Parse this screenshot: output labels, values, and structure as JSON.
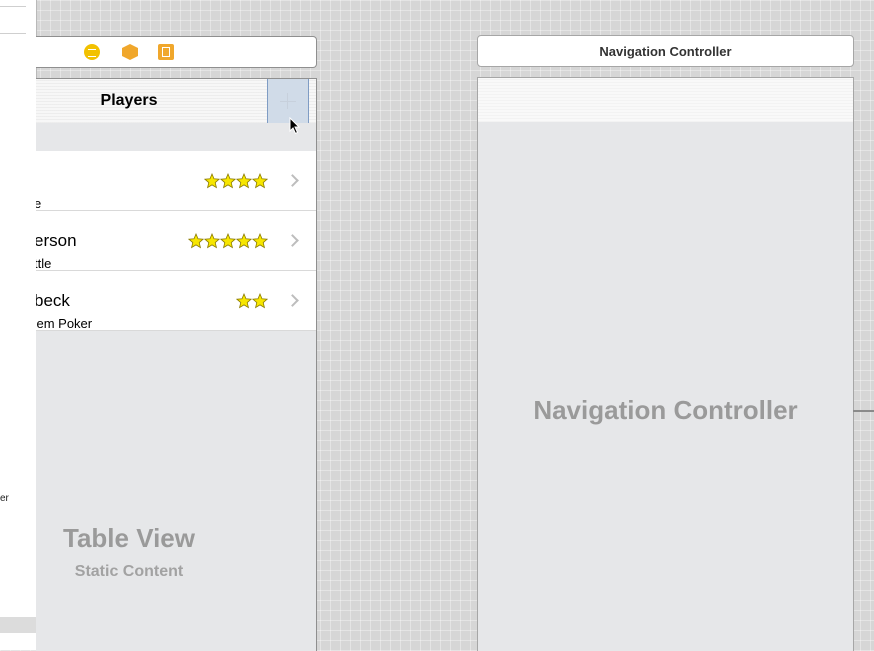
{
  "left_panel": {
    "fragment_text": "er"
  },
  "table_scene": {
    "dock_icons": [
      "view-controller-icon",
      "first-responder-icon",
      "exit-icon"
    ],
    "nav_title": "Players",
    "add_button_icon": "plus-icon",
    "cells": [
      {
        "name": "",
        "subtitle": "e",
        "rating": 4
      },
      {
        "name": "erson",
        "subtitle": "ttle",
        "rating": 5
      },
      {
        "name": "beck",
        "subtitle": "'em Poker",
        "rating": 2
      }
    ],
    "content_title": "Table View",
    "content_subtitle": "Static Content"
  },
  "nav_scene": {
    "dock_title": "Navigation Controller",
    "content_title": "Navigation Controller"
  },
  "colors": {
    "canvas": "#d6d6d6",
    "star": "#f7e600",
    "placeholder_text": "#9a9a9a",
    "selection": "#d0dbe8"
  }
}
